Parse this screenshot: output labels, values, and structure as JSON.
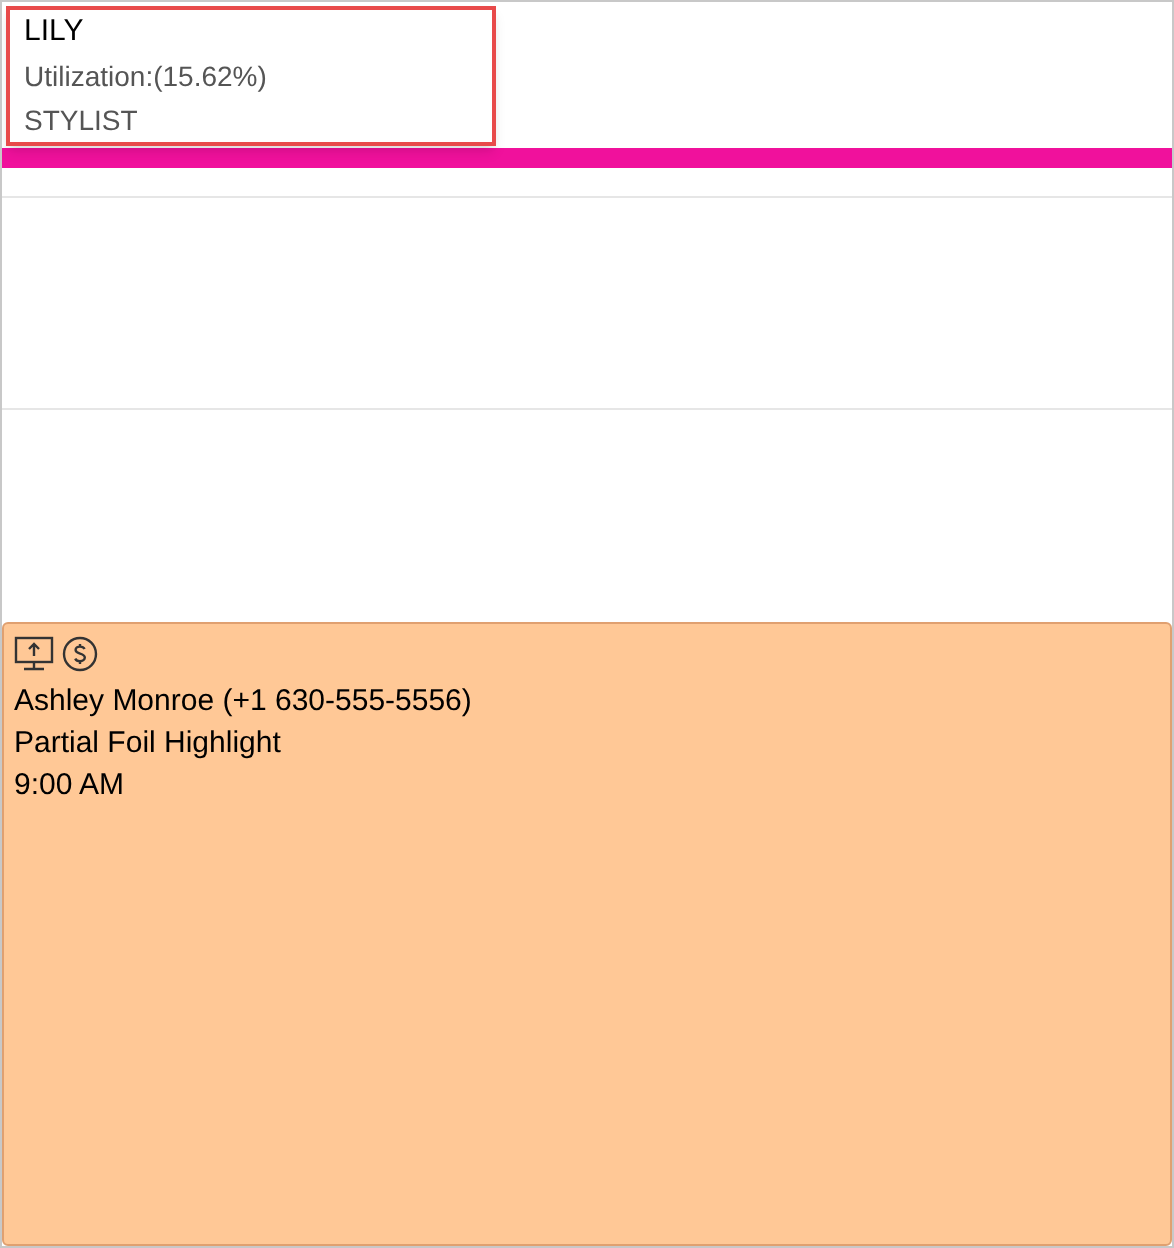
{
  "staff": {
    "name": "LILY",
    "utilization": "Utilization:(15.62%)",
    "role": "STYLIST"
  },
  "appointment": {
    "client": "Ashley Monroe (+1 630-555-5556)",
    "service": "Partial Foil Highlight",
    "time": "9:00 AM"
  }
}
